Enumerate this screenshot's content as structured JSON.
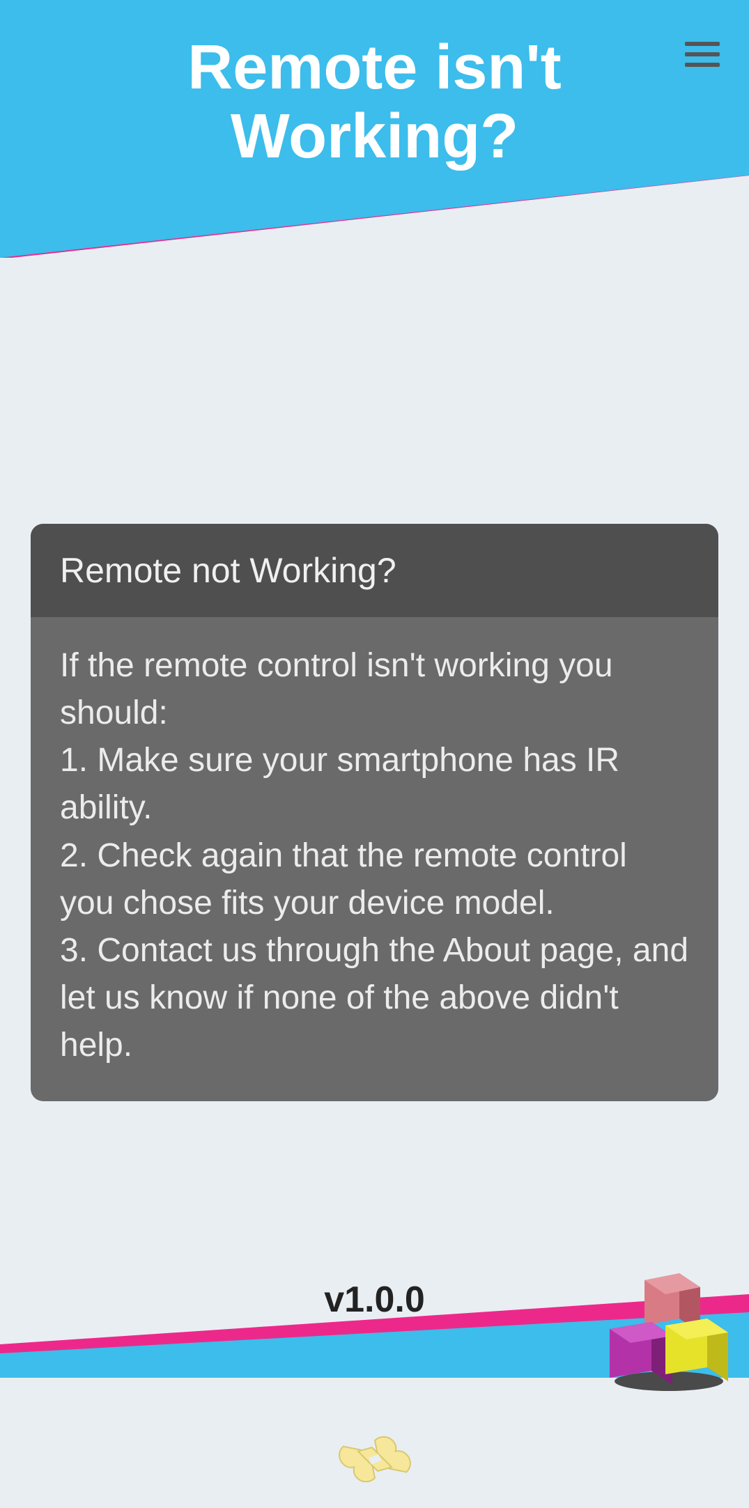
{
  "header": {
    "title": "Remote isn't Working?"
  },
  "card": {
    "header": "Remote not Working?",
    "body": "If the remote control isn't working you should:\n1. Make sure your smartphone has IR ability.\n2. Check again that the remote control you chose fits your device model.\n3. Contact us through the About page, and let us know if none of the above didn't help."
  },
  "footer": {
    "version": "v1.0.0"
  },
  "icons": {
    "menu": "menu",
    "decoration": "bone",
    "cubes": "cubes"
  }
}
